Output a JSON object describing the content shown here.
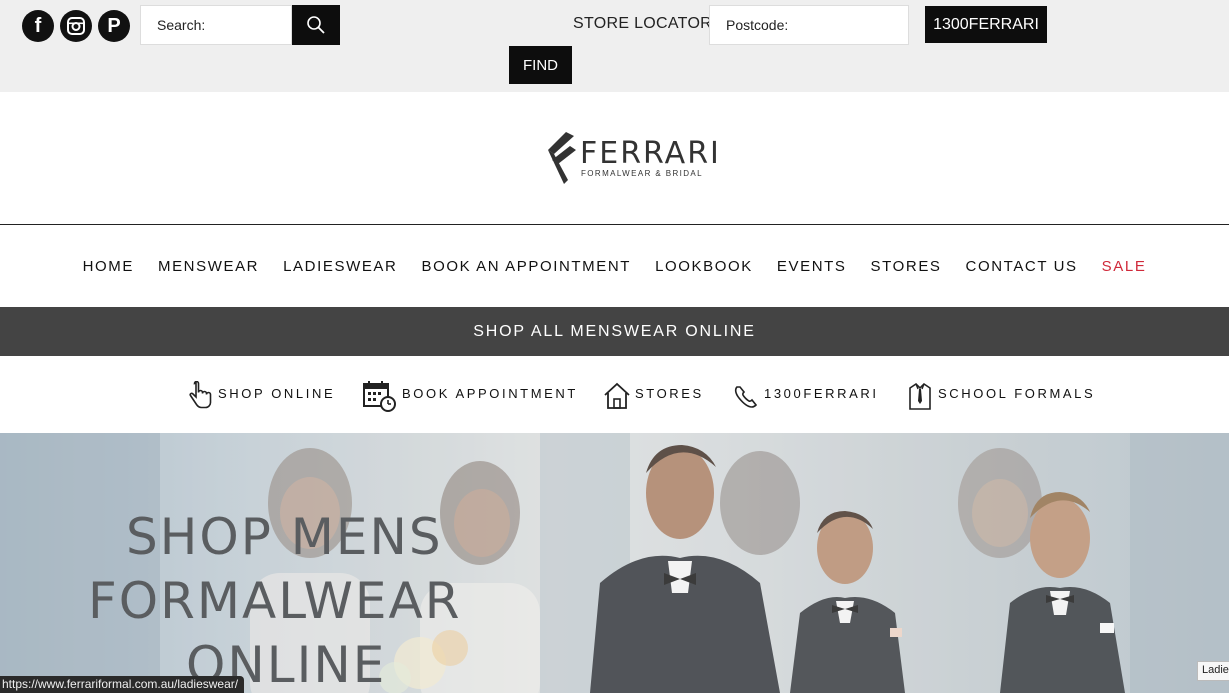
{
  "topbar": {
    "social": [
      {
        "name": "facebook-icon",
        "glyph": "f"
      },
      {
        "name": "instagram-icon",
        "glyph": ""
      },
      {
        "name": "pinterest-icon",
        "glyph": "P"
      }
    ],
    "search_placeholder": "Search:",
    "store_locator_label": "STORE LOCATOR",
    "postcode_placeholder": "Postcode:",
    "phone_label": "1300FERRARI",
    "find_label": "FIND"
  },
  "logo": {
    "word": "FERRARI",
    "tagline": "FORMALWEAR & BRIDAL"
  },
  "nav": {
    "items": [
      {
        "label": "HOME"
      },
      {
        "label": "MENSWEAR"
      },
      {
        "label": "LADIESWEAR"
      },
      {
        "label": "BOOK AN APPOINTMENT"
      },
      {
        "label": "LOOKBOOK"
      },
      {
        "label": "EVENTS"
      },
      {
        "label": "STORES"
      },
      {
        "label": "CONTACT US"
      },
      {
        "label": "SALE"
      }
    ],
    "sale_color": "#d0293a"
  },
  "banner": {
    "label": "SHOP ALL MENSWEAR ONLINE",
    "background": "#444444"
  },
  "quick_links": [
    {
      "label": "SHOP ONLINE",
      "icon": "pointer-hand-icon"
    },
    {
      "label": "BOOK APPOINTMENT",
      "icon": "calendar-clock-icon"
    },
    {
      "label": "STORES",
      "icon": "home-icon"
    },
    {
      "label": "1300FERRARI",
      "icon": "phone-icon"
    },
    {
      "label": "SCHOOL FORMALS",
      "icon": "shirt-tie-icon"
    }
  ],
  "hero": {
    "lines": [
      "SHOP MENS",
      "FORMALWEAR",
      "ONLINE"
    ]
  },
  "status": {
    "url": "https://www.ferrariformal.com.au/ladieswear/",
    "corner_tooltip": "Ladie"
  }
}
